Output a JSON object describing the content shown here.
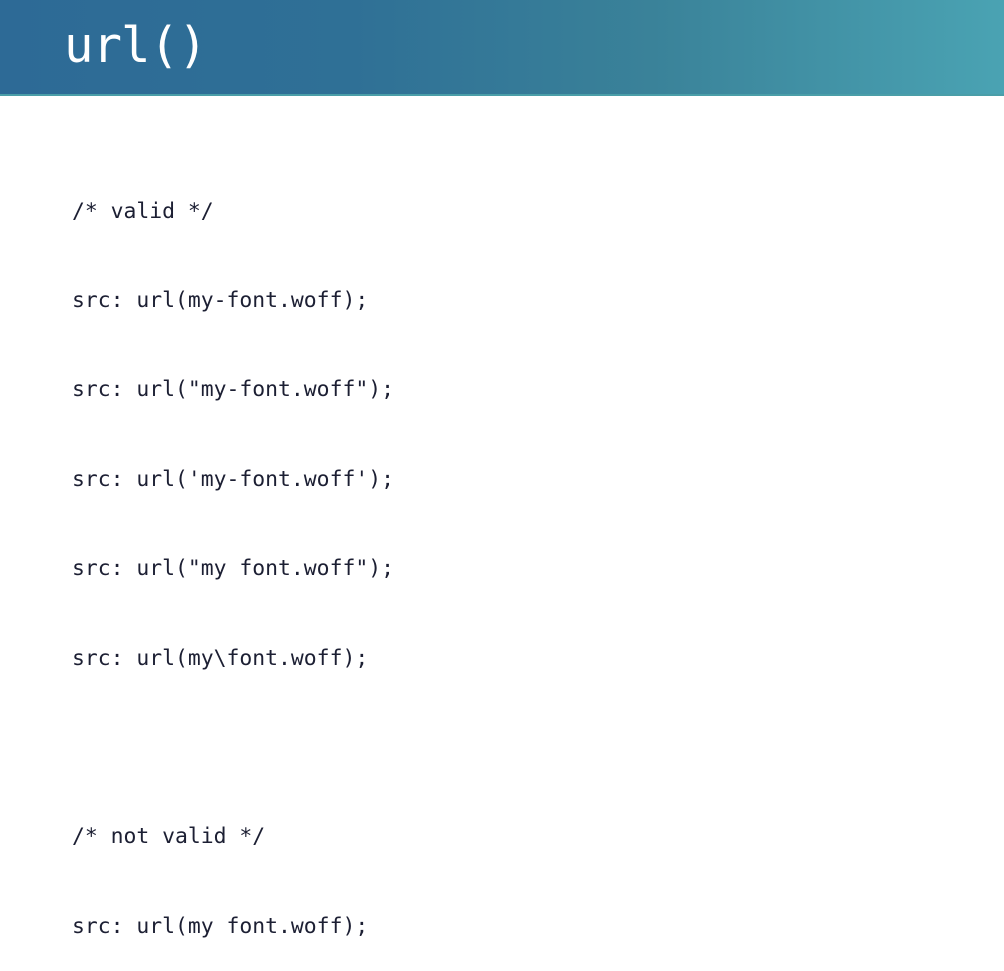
{
  "slide": {
    "title": "url()",
    "code_lines": [
      "/* valid */",
      "src: url(my-font.woff);",
      "src: url(\"my-font.woff\");",
      "src: url('my-font.woff');",
      "src: url(\"my font.woff\");",
      "src: url(my\\font.woff);",
      "",
      "/* not valid */",
      "src: url(my font.woff);"
    ]
  }
}
